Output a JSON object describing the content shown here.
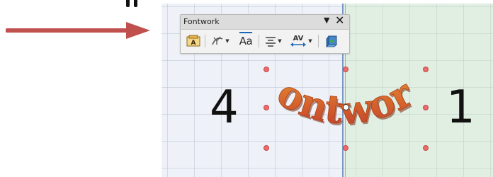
{
  "toolbar": {
    "title": "Fontwork",
    "menu_glyph": "▼",
    "close_glyph": "✕",
    "tools": [
      {
        "name": "fontwork-gallery",
        "icon": "fontwork-gallery-icon"
      },
      {
        "name": "fontwork-shape",
        "icon": "fontwork-shape-icon"
      },
      {
        "name": "fontwork-same-letter-heights",
        "icon": "same-letter-heights-icon",
        "label": "Aa"
      },
      {
        "name": "fontwork-alignment",
        "icon": "align-center-icon"
      },
      {
        "name": "fontwork-character-spacing",
        "icon": "character-spacing-icon",
        "label": "AV"
      },
      {
        "name": "toggle-extrusion",
        "icon": "extrusion-icon"
      }
    ]
  },
  "canvas": {
    "left_number": "4",
    "right_number": "1",
    "fontwork_text": "Fontwork"
  },
  "colors": {
    "arrow": "#c0504d",
    "page_border": "#5a7fb6",
    "handle": "#ef6a6a",
    "fontwork_top": "#f5c04a",
    "fontwork_bottom": "#c0392b"
  }
}
